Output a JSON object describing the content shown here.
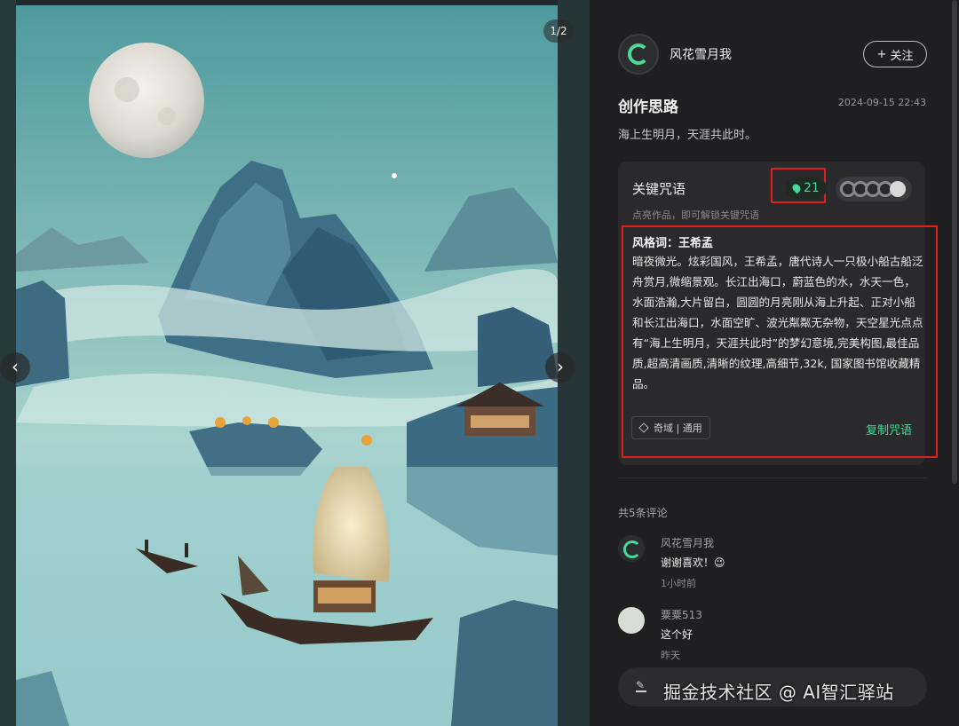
{
  "viewer": {
    "counter": "1/2",
    "prev_label": "‹",
    "next_label": "›"
  },
  "author": {
    "name": "风花雪月我",
    "follow_label": "关注",
    "follow_icon": "+"
  },
  "post": {
    "section_title": "创作思路",
    "date": "2024-09-15 22:43",
    "intro": "海上生明月，天涯共此时。"
  },
  "prompt_card": {
    "title": "关键咒语",
    "usage_count": "21",
    "hint": "点亮作品，即可解锁关键咒语",
    "style_label": "风格词：王希孟",
    "text": "暗夜微光。炫彩国风，王希孟，唐代诗人一只极小船古船泛舟赏月,微缩景观。长江出海口，蔚蓝色的水，水天一色，水面浩瀚,大片留白，圆圆的月亮刚从海上升起、正对小船和长江出海口，水面空旷、波光粼粼无杂物，天空星光点点有“海上生明月，天涯共此时”的梦幻意境,完美构图,最佳品质,超高清画质,清晰的纹理,高细节,32k, 国家图书馆收藏精品。",
    "tag": "奇域 | 通用",
    "copy_label": "复制咒语"
  },
  "comments": {
    "count_label": "共5条评论",
    "items": [
      {
        "name": "风花雪月我",
        "text": "谢谢喜欢！😉",
        "time": "1小时前"
      },
      {
        "name": "粟粟513",
        "text": "这个好",
        "time": "昨天"
      }
    ]
  },
  "watermark": "掘金技术社区 @ AI智汇驿站",
  "colors": {
    "accent": "#4bd89a",
    "highlight": "#e02020",
    "panel_bg": "#1f1f21"
  },
  "icons": [
    "location-pin-icon",
    "cube-icon",
    "pen-icon",
    "plus-icon"
  ]
}
